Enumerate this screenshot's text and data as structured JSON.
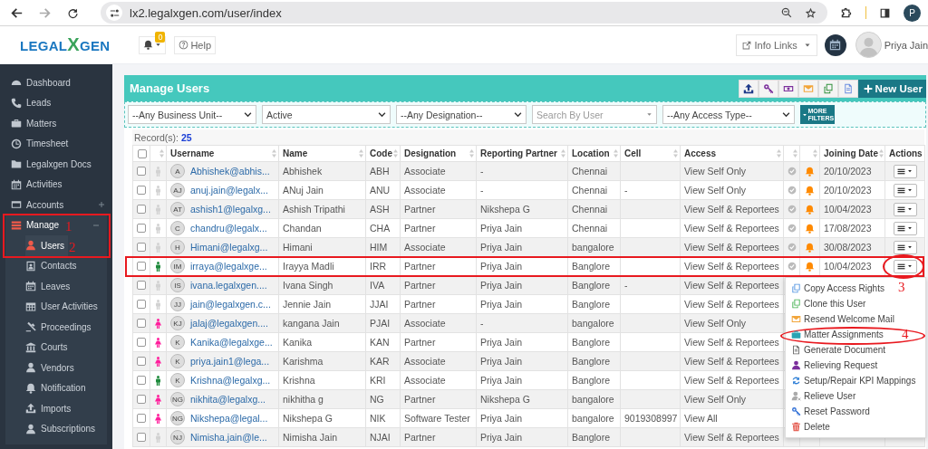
{
  "browser": {
    "url": "lx2.legalxgen.com/user/index",
    "profile_initial": "P"
  },
  "header": {
    "logo": {
      "left": "LEGAL",
      "mark": "X",
      "right": "GEN"
    },
    "notification_count": "0",
    "help": "Help",
    "info_links": "Info Links",
    "user_name": "Priya Jain"
  },
  "sidebar": {
    "items": [
      {
        "label": "Dashboard",
        "kind": "gauge",
        "selected": false
      },
      {
        "label": "Leads",
        "kind": "phone",
        "selected": false
      },
      {
        "label": "Matters",
        "kind": "briefcase",
        "selected": false
      },
      {
        "label": "Timesheet",
        "kind": "clock",
        "selected": false
      },
      {
        "label": "Legalxgen Docs",
        "kind": "folder",
        "selected": false
      },
      {
        "label": "Activities",
        "kind": "calendar",
        "selected": false
      },
      {
        "label": "Accounts",
        "kind": "card",
        "selected": false,
        "expanded": false
      },
      {
        "label": "Manage",
        "kind": "bars",
        "selected": false,
        "expanded": true,
        "children": [
          {
            "label": "Users",
            "kind": "user",
            "selected": true
          },
          {
            "label": "Contacts",
            "kind": "contact",
            "selected": false
          },
          {
            "label": "Leaves",
            "kind": "calendar",
            "selected": false
          },
          {
            "label": "User Activities",
            "kind": "grid",
            "selected": false
          },
          {
            "label": "Proceedings",
            "kind": "gavel",
            "selected": false
          },
          {
            "label": "Courts",
            "kind": "building",
            "selected": false
          },
          {
            "label": "Vendors",
            "kind": "user",
            "selected": false
          },
          {
            "label": "Notification",
            "kind": "bell",
            "selected": false
          },
          {
            "label": "Imports",
            "kind": "upload",
            "selected": false
          },
          {
            "label": "Subscriptions",
            "kind": "user",
            "selected": false
          }
        ]
      }
    ]
  },
  "panel": {
    "title": "Manage Users",
    "toolbar": [
      {
        "kind": "upload"
      },
      {
        "kind": "key"
      },
      {
        "kind": "banknote"
      },
      {
        "kind": "envelope"
      },
      {
        "kind": "copy"
      },
      {
        "kind": "document"
      }
    ],
    "new_user": "New User",
    "filters": [
      {
        "kind": "select",
        "value": "--Any Business Unit--"
      },
      {
        "kind": "select",
        "value": "Active"
      },
      {
        "kind": "select",
        "value": "--Any Designation--"
      },
      {
        "kind": "search",
        "placeholder": "Search By User"
      },
      {
        "kind": "select",
        "value": "--Any Access Type--"
      }
    ],
    "more_filters": "MORE FILTERS",
    "records": {
      "label": "Record(s):",
      "count": "25"
    }
  },
  "table": {
    "select_all": {
      "checked": false
    },
    "columns": [
      {
        "kind": "sortable"
      },
      {
        "label": "Username",
        "kind": "sortable"
      },
      {
        "label": "Name",
        "kind": "sortable"
      },
      {
        "label": "Code",
        "kind": "sortable"
      },
      {
        "label": "Designation",
        "kind": "sortable"
      },
      {
        "label": "Reporting Partner",
        "kind": "sortable"
      },
      {
        "label": "Location",
        "kind": "sortable"
      },
      {
        "label": "Cell",
        "kind": "sortable"
      },
      {
        "label": "Access",
        "kind": "sortable"
      },
      {
        "kind": "sortable"
      },
      {
        "kind": "sortable"
      },
      {
        "label": "Joining Date",
        "kind": "sortable"
      },
      {
        "label": "Actions",
        "kind": "plain"
      }
    ],
    "rows": [
      {
        "checked": false,
        "kind": "none",
        "initials": "A",
        "username": "Abhishek@abhis...",
        "name": "Abhishek",
        "code": "ABH",
        "designation": "Associate",
        "reporting_partner": "-",
        "location": "Chennai",
        "access": "View Self Only",
        "status_icon": true,
        "alert_icon": true,
        "joining_date": "20/10/2023",
        "actions_button": true
      },
      {
        "checked": false,
        "kind": "none",
        "initials": "AJ",
        "username": "anuj.jain@legalx...",
        "name": "ANuj Jain",
        "code": "ANU",
        "designation": "Associate",
        "reporting_partner": "-",
        "location": "Chennai",
        "cell": "-",
        "access": "View Self Only",
        "status_icon": true,
        "alert_icon": true,
        "joining_date": "20/10/2023",
        "actions_button": true
      },
      {
        "checked": false,
        "kind": "none",
        "initials": "AT",
        "username": "ashish1@legalxg...",
        "name": "Ashish Tripathi",
        "code": "ASH",
        "designation": "Partner",
        "reporting_partner": "Nikshepa G",
        "location": "Chennai",
        "access": "View Self & Reportees",
        "status_icon": true,
        "alert_icon": true,
        "joining_date": "10/04/2023",
        "actions_button": true
      },
      {
        "checked": false,
        "kind": "none",
        "initials": "C",
        "username": "chandru@legalx...",
        "name": "Chandan",
        "code": "CHA",
        "designation": "Partner",
        "reporting_partner": "Priya Jain",
        "location": "Chennai",
        "access": "View Self & Reportees",
        "status_icon": true,
        "alert_icon": true,
        "joining_date": "17/08/2023",
        "actions_button": true
      },
      {
        "checked": false,
        "kind": "none",
        "initials": "H",
        "username": "Himani@legalxg...",
        "name": "Himani",
        "code": "HIM",
        "designation": "Associate",
        "reporting_partner": "Priya Jain",
        "location": "bangalore",
        "access": "View Self & Reportees",
        "status_icon": true,
        "alert_icon": true,
        "joining_date": "30/08/2023",
        "actions_button": true
      },
      {
        "checked": false,
        "kind": "male",
        "initials": "IM",
        "username": "irraya@legalxge...",
        "name": "Irayya Madli",
        "code": "IRR",
        "designation": "Partner",
        "reporting_partner": "Priya Jain",
        "location": "Banglore",
        "access": "View Self & Reportees",
        "status_icon": true,
        "alert_icon": true,
        "joining_date": "10/04/2023",
        "actions_button": true
      },
      {
        "checked": false,
        "kind": "none",
        "initials": "IS",
        "username": "ivana.legalxgen....",
        "name": "Ivana Singh",
        "code": "IVA",
        "designation": "Partner",
        "reporting_partner": "Priya Jain",
        "location": "Banglore",
        "cell": "-",
        "access": "View Self & Reportees"
      },
      {
        "checked": false,
        "kind": "none",
        "initials": "JJ",
        "username": "jain@legalxgen.c...",
        "name": "Jennie Jain",
        "code": "JJAI",
        "designation": "Partner",
        "reporting_partner": "Priya Jain",
        "location": "Banglore",
        "access": "View Self & Reportees"
      },
      {
        "checked": false,
        "kind": "female",
        "initials": "KJ",
        "username": "jalaj@legalxgen....",
        "name": "kangana Jain",
        "code": "PJAI",
        "designation": "Associate",
        "reporting_partner": "-",
        "location": "bangalore",
        "access": "View Self Only"
      },
      {
        "checked": false,
        "kind": "female",
        "initials": "K",
        "username": "Kanika@legalxge...",
        "name": "Kanika",
        "code": "KAN",
        "designation": "Partner",
        "reporting_partner": "Priya Jain",
        "location": "Banglore",
        "access": "View Self & Reportees"
      },
      {
        "checked": false,
        "kind": "female",
        "initials": "K",
        "username": "priya.jain1@lega...",
        "name": "Karishma",
        "code": "KAR",
        "designation": "Associate",
        "reporting_partner": "Priya Jain",
        "location": "Banglore",
        "access": "View Self & Reportees"
      },
      {
        "checked": false,
        "kind": "male",
        "initials": "K",
        "username": "Krishna@legalxg...",
        "name": "Krishna",
        "code": "KRI",
        "designation": "Associate",
        "reporting_partner": "Priya Jain",
        "location": "Banglore",
        "access": "View Self & Reportees"
      },
      {
        "checked": false,
        "kind": "female",
        "initials": "NG",
        "username": "nikhita@legalxg...",
        "name": "nikhitha g",
        "code": "NG",
        "designation": "Partner",
        "reporting_partner": "Nikshepa G",
        "location": "bangalore",
        "access": "View Self Only"
      },
      {
        "checked": false,
        "kind": "female",
        "initials": "NG",
        "username": "Nikshepa@legal...",
        "name": "Nikshepa G",
        "code": "NIK",
        "designation": "Software Tester",
        "reporting_partner": "Priya Jain",
        "location": "bangalore",
        "cell": "9019308997",
        "access": "View All"
      },
      {
        "checked": false,
        "kind": "none",
        "initials": "NJ",
        "username": "Nimisha.jain@le...",
        "name": "Nimisha Jain",
        "code": "NJAI",
        "designation": "Partner",
        "reporting_partner": "Priya Jain",
        "location": "Banglore",
        "access": "View Self & Reportees"
      }
    ]
  },
  "action_menu": {
    "items": [
      {
        "label": "Copy Access Rights",
        "kind": "copy"
      },
      {
        "label": "Clone this User",
        "kind": "clone"
      },
      {
        "label": "Resend Welcome Mail",
        "kind": "envelope"
      },
      {
        "label": "Matter Assignments",
        "kind": "briefcase"
      },
      {
        "label": "Generate Document",
        "kind": "document"
      },
      {
        "label": "Relieving Request",
        "kind": "user"
      },
      {
        "label": "Setup/Repair KPI Mappings",
        "kind": "refresh"
      },
      {
        "label": "Relieve User",
        "kind": "user-off"
      },
      {
        "label": "Reset Password",
        "kind": "key"
      },
      {
        "label": "Delete",
        "kind": "trash"
      }
    ]
  },
  "annotations": [
    {
      "kind": "box"
    },
    {
      "kind": "label",
      "text": "1"
    },
    {
      "kind": "label",
      "text": "2"
    },
    {
      "kind": "box"
    },
    {
      "kind": "ellipse"
    },
    {
      "kind": "label",
      "text": "3"
    },
    {
      "kind": "ellipse"
    },
    {
      "kind": "label",
      "text": "4"
    }
  ]
}
